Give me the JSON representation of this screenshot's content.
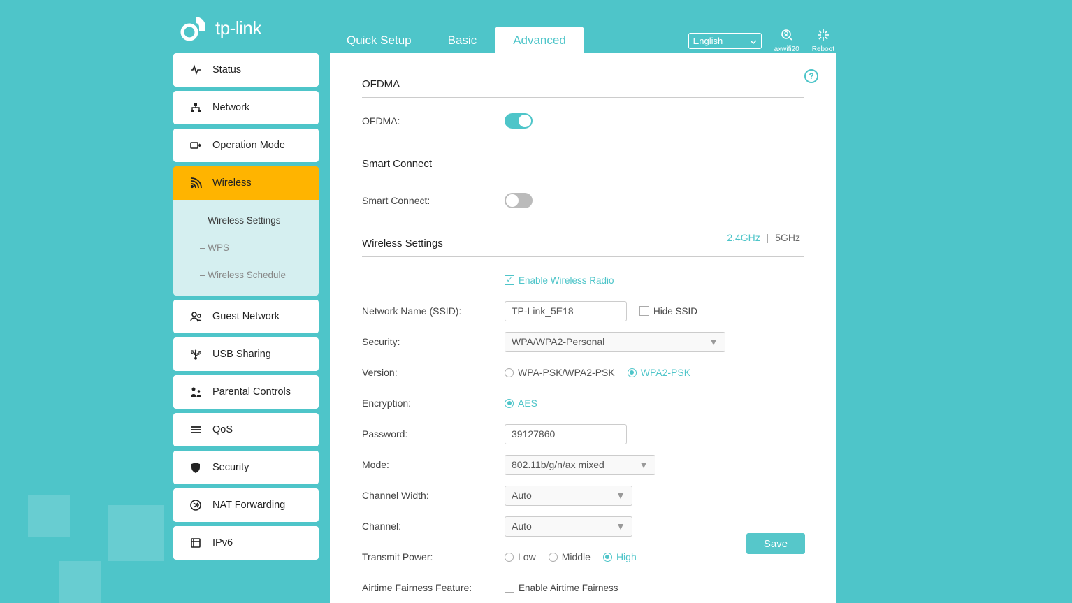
{
  "brand": "tp-link",
  "topnav": {
    "tabs": [
      "Quick Setup",
      "Basic",
      "Advanced"
    ],
    "active": 2,
    "language": "English",
    "user_label": "axwifi20",
    "reboot_label": "Reboot"
  },
  "sidebar": {
    "items": [
      {
        "label": "Status"
      },
      {
        "label": "Network"
      },
      {
        "label": "Operation Mode"
      },
      {
        "label": "Wireless",
        "active": true,
        "sub": [
          {
            "label": "Wireless Settings",
            "active": true
          },
          {
            "label": "WPS"
          },
          {
            "label": "Wireless Schedule"
          }
        ]
      },
      {
        "label": "Guest Network"
      },
      {
        "label": "USB Sharing"
      },
      {
        "label": "Parental Controls"
      },
      {
        "label": "QoS"
      },
      {
        "label": "Security"
      },
      {
        "label": "NAT Forwarding"
      },
      {
        "label": "IPv6"
      }
    ]
  },
  "sections": {
    "ofdma": {
      "title": "OFDMA",
      "label": "OFDMA:",
      "enabled": true
    },
    "smart_connect": {
      "title": "Smart Connect",
      "label": "Smart Connect:",
      "enabled": false
    },
    "wireless": {
      "title": "Wireless Settings",
      "bands": [
        "2.4GHz",
        "5GHz"
      ],
      "active_band": 0,
      "enable_radio_label": "Enable Wireless Radio",
      "enable_radio": true,
      "fields": {
        "ssid": {
          "label": "Network Name (SSID):",
          "value": "TP-Link_5E18",
          "hide_label": "Hide SSID",
          "hide": false
        },
        "security": {
          "label": "Security:",
          "value": "WPA/WPA2-Personal"
        },
        "version": {
          "label": "Version:",
          "options": [
            "WPA-PSK/WPA2-PSK",
            "WPA2-PSK"
          ],
          "selected": 1
        },
        "encryption": {
          "label": "Encryption:",
          "options": [
            "AES"
          ],
          "selected": 0
        },
        "password": {
          "label": "Password:",
          "value": "39127860"
        },
        "mode": {
          "label": "Mode:",
          "value": "802.11b/g/n/ax mixed"
        },
        "channel_width": {
          "label": "Channel Width:",
          "value": "Auto"
        },
        "channel": {
          "label": "Channel:",
          "value": "Auto"
        },
        "transmit_power": {
          "label": "Transmit Power:",
          "options": [
            "Low",
            "Middle",
            "High"
          ],
          "selected": 2
        },
        "airtime": {
          "label": "Airtime Fairness Feature:",
          "check_label": "Enable Airtime Fairness",
          "checked": false
        }
      },
      "save_label": "Save"
    }
  }
}
